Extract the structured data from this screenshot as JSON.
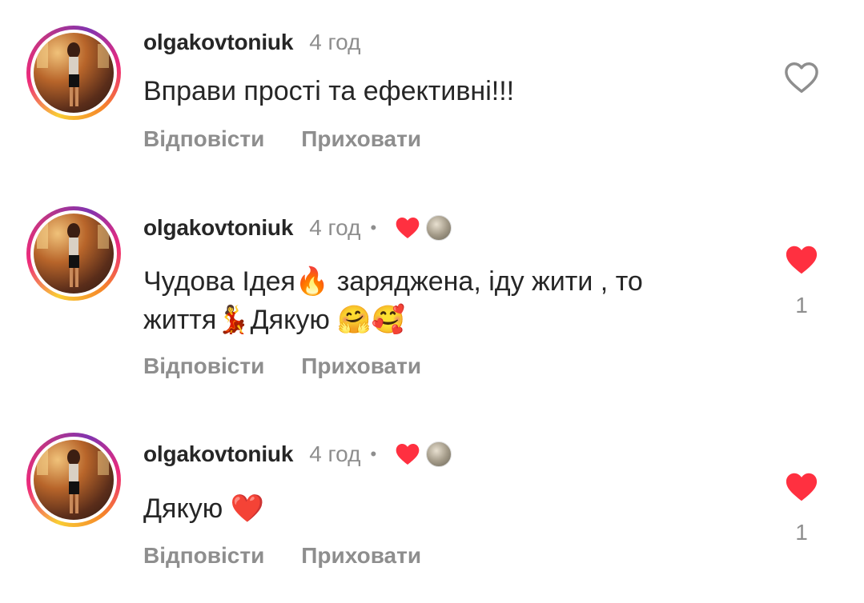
{
  "comments": [
    {
      "username": "olgakovtoniuk",
      "time": "4 год",
      "text": "Вправи прості та ефективні!!!",
      "reply_label": "Відповісти",
      "hide_label": "Приховати",
      "liked": false,
      "like_count": ""
    },
    {
      "username": "olgakovtoniuk",
      "time": "4 год",
      "separator": "•",
      "text_line1": "Чудова Ідея🔥  заряджена, іду жити , то",
      "text_line2": "життя💃Дякую 🤗🥰",
      "reply_label": "Відповісти",
      "hide_label": "Приховати",
      "liked": true,
      "like_count": "1"
    },
    {
      "username": "olgakovtoniuk",
      "time": "4 год",
      "separator": "•",
      "text": "Дякую ❤️",
      "reply_label": "Відповісти",
      "hide_label": "Приховати",
      "liked": true,
      "like_count": "1"
    }
  ],
  "colors": {
    "like_red": "#ff3040",
    "muted_text": "#8e8e8e",
    "primary_text": "#262626",
    "outline_icon": "#8e8e8e"
  },
  "icons": {
    "like_outline": "heart-outline-icon",
    "like_filled": "heart-filled-icon",
    "creator_liked": "creator-heart-icon"
  }
}
